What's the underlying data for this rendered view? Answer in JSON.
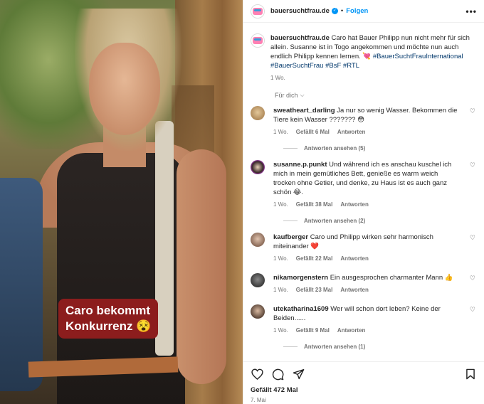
{
  "media": {
    "overlay_text_line1": "Caro bekommt",
    "overlay_text_line2": "Konkurrenz",
    "overlay_emoji": "😵"
  },
  "header": {
    "username": "bauersuchtfrau.de",
    "verified_icon": "verified-badge-icon",
    "separator": "•",
    "follow_label": "Folgen",
    "more_icon": "more-options-icon"
  },
  "caption": {
    "username": "bauersuchtfrau.de",
    "text": "Caro hat Bauer Philipp nun nicht mehr für sich allein. Susanne ist in Togo angekommen und möchte nun auch endlich Philipp kennen lernen. 💘",
    "hashtags": "#BauerSuchtFrauInternational #BauerSuchtFrau #BsF #RTL",
    "time": "1 Wo."
  },
  "sort_label": "Für dich",
  "comments": [
    {
      "username": "sweatheart_darling",
      "text": "Ja nur so wenig Wasser. Bekommen die Tiere kein Wasser ??????? 😳",
      "time": "1 Wo.",
      "likes": "Gefällt 6 Mal",
      "reply": "Antworten",
      "view_replies": "Antworten ansehen (5)",
      "avatar_color": "#c9a97a"
    },
    {
      "username": "susanne.p.punkt",
      "text": "Und während ich es anschau kuschel ich mich in mein gemütliches Bett, genieße es warm weich trocken ohne Getier, und denke, zu Haus ist es auch ganz schön 😂.",
      "time": "1 Wo.",
      "likes": "Gefällt 38 Mal",
      "reply": "Antworten",
      "view_replies": "Antworten ansehen (2)",
      "avatar_color": "#9b3aa8"
    },
    {
      "username": "kaufberger",
      "text": "Caro und Philipp wirken sehr harmonisch miteinander ❤️",
      "time": "1 Wo.",
      "likes": "Gefällt 22 Mal",
      "reply": "Antworten",
      "avatar_color": "#a8826a"
    },
    {
      "username": "nikamorgenstern",
      "text": "Ein ausgesprochen charmanter Mann 👍",
      "time": "1 Wo.",
      "likes": "Gefällt 23 Mal",
      "reply": "Antworten",
      "avatar_color": "#4a4a4a"
    },
    {
      "username": "utekatharina1609",
      "text": "Wer will schon dort leben? Keine der Beiden......",
      "time": "1 Wo.",
      "likes": "Gefällt 9 Mal",
      "reply": "Antworten",
      "view_replies": "Antworten ansehen (1)",
      "avatar_color": "#6b5a4a"
    }
  ],
  "actions": {
    "likes": "Gefällt 472 Mal",
    "date": "7. Mai"
  },
  "colors": {
    "accent": "#0095f6",
    "badge_bg": "#8c1d1d",
    "hashtag": "#00376b",
    "muted": "#737373"
  }
}
